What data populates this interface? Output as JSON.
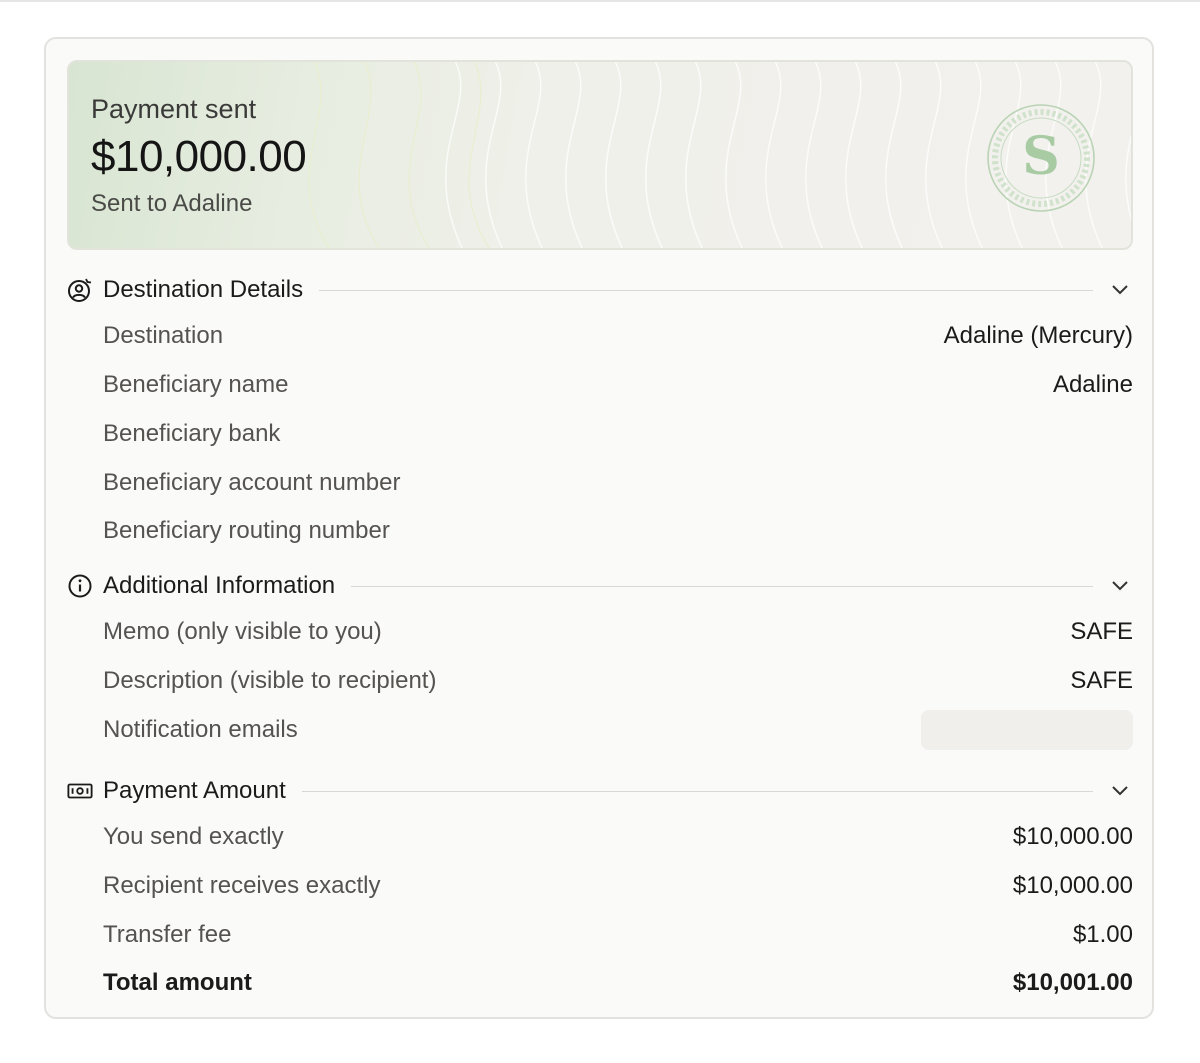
{
  "banner": {
    "label": "Payment sent",
    "amount": "$10,000.00",
    "subtitle": "Sent to Adaline"
  },
  "sections": {
    "destination": {
      "title": "Destination Details",
      "icon": "user-circle-icon",
      "rows": [
        {
          "label": "Destination",
          "value": "Adaline (Mercury)"
        },
        {
          "label": "Beneficiary name",
          "value": "Adaline"
        },
        {
          "label": "Beneficiary bank",
          "value": ""
        },
        {
          "label": "Beneficiary account number",
          "value": ""
        },
        {
          "label": "Beneficiary routing number",
          "value": ""
        }
      ]
    },
    "additional": {
      "title": "Additional Information",
      "icon": "info-circle-icon",
      "rows": [
        {
          "label": "Memo (only visible to you)",
          "value": "SAFE"
        },
        {
          "label": "Description (visible to recipient)",
          "value": "SAFE"
        },
        {
          "label": "Notification emails",
          "value": ""
        }
      ]
    },
    "payment": {
      "title": "Payment Amount",
      "icon": "banknote-icon",
      "rows": [
        {
          "label": "You send exactly",
          "value": "$10,000.00"
        },
        {
          "label": "Recipient receives exactly",
          "value": "$10,000.00"
        },
        {
          "label": "Transfer fee",
          "value": "$1.00"
        },
        {
          "label": "Total amount",
          "value": "$10,001.00"
        }
      ]
    }
  },
  "colors": {
    "banner_green": "#d8e5d2",
    "seal_green": "#9fc49a",
    "text_primary": "#1b1b1b",
    "text_secondary": "#55534f"
  }
}
